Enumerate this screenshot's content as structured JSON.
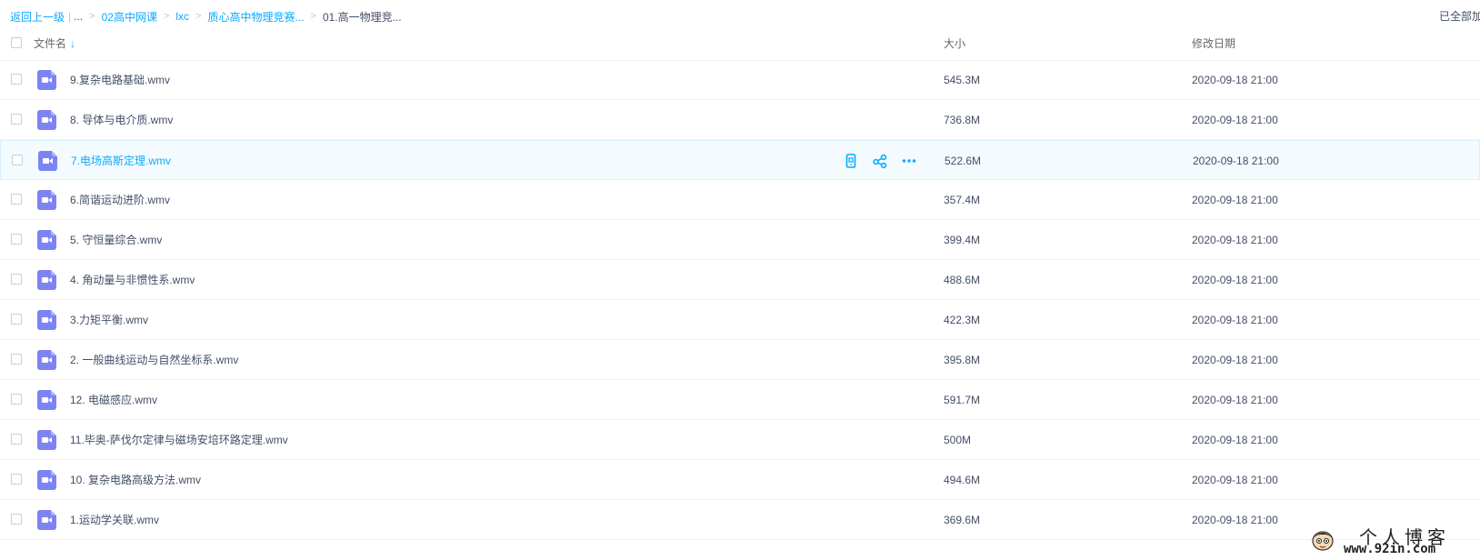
{
  "breadcrumb": {
    "back": "返回上一级",
    "ellipsis": "...",
    "items": [
      "02高中网课",
      "lxc",
      "质心高中物理竞赛...",
      "01.高一物理竞..."
    ]
  },
  "top_right_text": "已全部加",
  "header": {
    "name": "文件名",
    "size": "大小",
    "date": "修改日期"
  },
  "files": [
    {
      "name": "9.复杂电路基础.wmv",
      "size": "545.3M",
      "date": "2020-09-18 21:00"
    },
    {
      "name": "8. 导体与电介质.wmv",
      "size": "736.8M",
      "date": "2020-09-18 21:00"
    },
    {
      "name": "7.电场高斯定理.wmv",
      "size": "522.6M",
      "date": "2020-09-18 21:00"
    },
    {
      "name": "6.简谐运动进阶.wmv",
      "size": "357.4M",
      "date": "2020-09-18 21:00"
    },
    {
      "name": "5. 守恒量综合.wmv",
      "size": "399.4M",
      "date": "2020-09-18 21:00"
    },
    {
      "name": "4. 角动量与非惯性系.wmv",
      "size": "488.6M",
      "date": "2020-09-18 21:00"
    },
    {
      "name": "3.力矩平衡.wmv",
      "size": "422.3M",
      "date": "2020-09-18 21:00"
    },
    {
      "name": "2. 一般曲线运动与自然坐标系.wmv",
      "size": "395.8M",
      "date": "2020-09-18 21:00"
    },
    {
      "name": "12. 电磁感应.wmv",
      "size": "591.7M",
      "date": "2020-09-18 21:00"
    },
    {
      "name": "11.毕奥-萨伐尔定律与磁场安培环路定理.wmv",
      "size": "500M",
      "date": "2020-09-18 21:00"
    },
    {
      "name": "10. 复杂电路高级方法.wmv",
      "size": "494.6M",
      "date": "2020-09-18 21:00"
    },
    {
      "name": "1.运动学关联.wmv",
      "size": "369.6M",
      "date": "2020-09-18 21:00"
    }
  ],
  "hover_row": 2,
  "file_icon": "video-file-icon",
  "row_actions": [
    "phone-icon",
    "share-icon",
    "more-icon"
  ],
  "watermark": {
    "title": "个人博客",
    "url": "www.92in.com"
  },
  "colors": {
    "accent": "#09aaff",
    "text": "#424e67",
    "video_icon": "#7c84f4",
    "hover_bg": "#f4fbff"
  }
}
